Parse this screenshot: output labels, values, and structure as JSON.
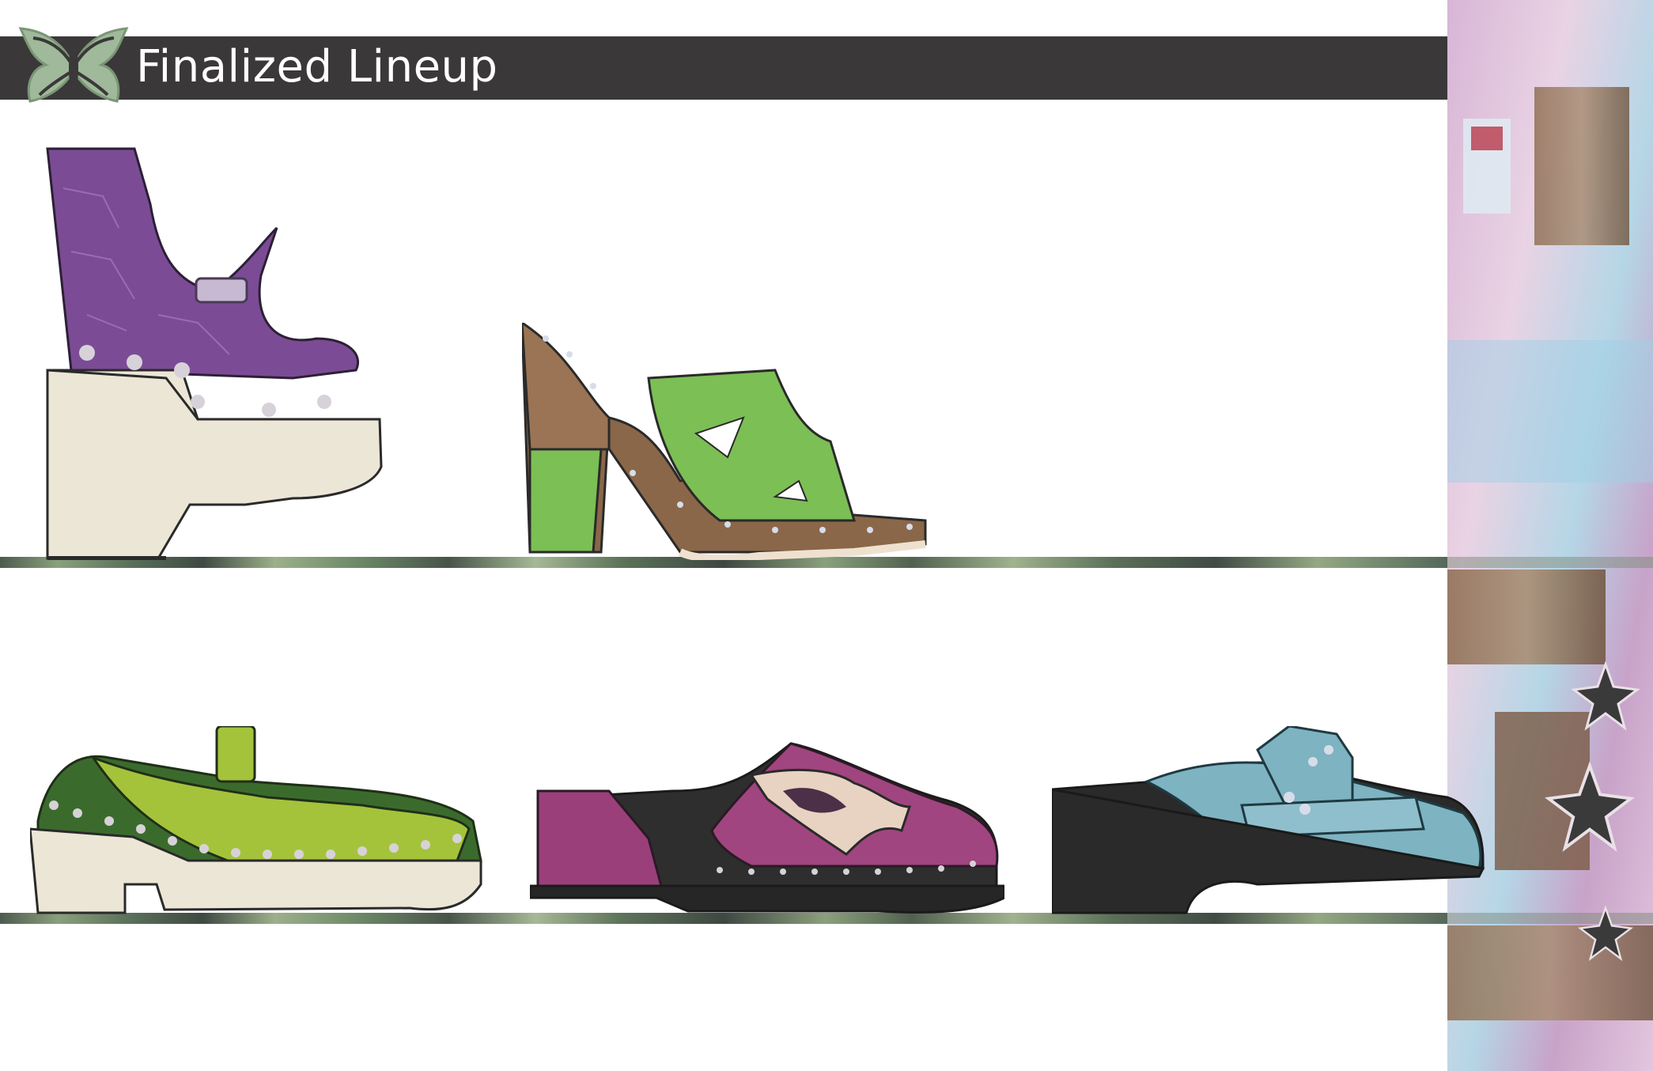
{
  "header": {
    "title": "Finalized Lineup",
    "logo_icon": "butterfly-logo-icon",
    "background_color": "#3a3839",
    "text_color": "#ffffff"
  },
  "shelves": {
    "count": 2,
    "color_palette": [
      "#4c5b4f",
      "#8aa07c",
      "#3f4a42"
    ]
  },
  "shoes": [
    {
      "name": "purple-croc-platform-boot",
      "upper_color": "#7b4c95",
      "sole_color": "#ebe6d6"
    },
    {
      "name": "green-wood-platform-mule",
      "upper_color": "#7cbf55",
      "sole_color": "#8a6748"
    },
    {
      "name": "lime-croc-mary-jane",
      "upper_color": "#a4c33b",
      "sole_color": "#ebe6d6"
    },
    {
      "name": "magenta-butterfly-clog",
      "upper_color": "#a0457f",
      "sole_color": "#2e2e2e"
    },
    {
      "name": "blue-croc-loafer-clog",
      "upper_color": "#7eb3c2",
      "sole_color": "#2a2a2a"
    }
  ],
  "collage": {
    "icons": [
      "star-icon",
      "star-icon",
      "star-icon"
    ],
    "colors": [
      "#c9a6c9",
      "#8b6b4f",
      "#b8d9e6",
      "#e7c8dd"
    ]
  }
}
